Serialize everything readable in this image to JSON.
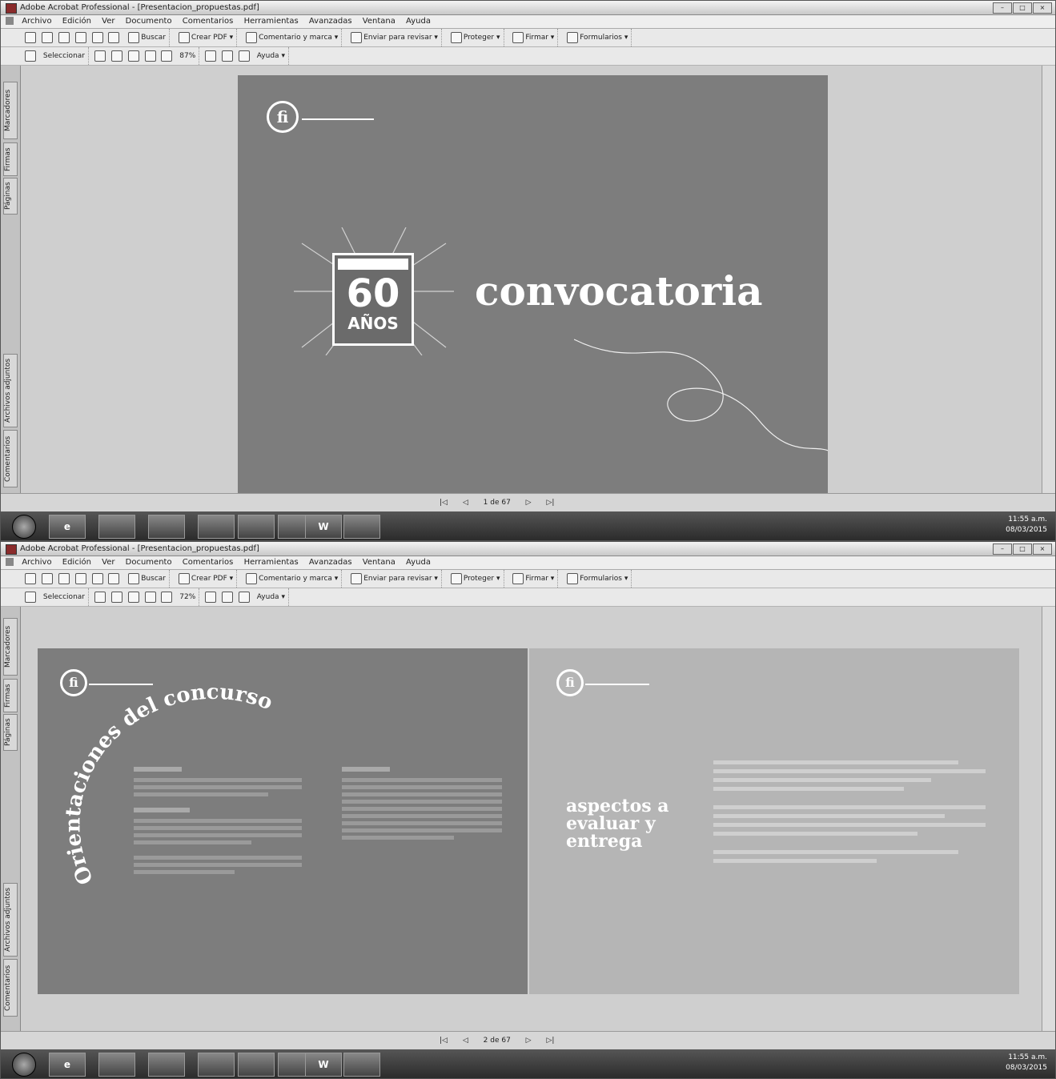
{
  "app": {
    "title": "Adobe Acrobat Professional - [Presentacion_propuestas.pdf]",
    "title_top": "Adobe Acrobat Professional - [Presentacion_propuestas.pdf]",
    "menu": [
      "Archivo",
      "Edición",
      "Ver",
      "Documento",
      "Comentarios",
      "Herramientas",
      "Avanzadas",
      "Ventana",
      "Ayuda"
    ]
  },
  "toolbar1": {
    "buscar": "Buscar",
    "crear_pdf": "Crear PDF",
    "comentario": "Comentario y marca",
    "enviar": "Enviar para revisar",
    "proteger": "Proteger",
    "firmar": "Firmar",
    "formularios": "Formularios"
  },
  "toolbar2": {
    "seleccionar": "Seleccionar",
    "zoom_top": "87%",
    "zoom_bottom": "72%",
    "ayuda": "Ayuda"
  },
  "nav_tabs": [
    "Marcadores",
    "Firmas",
    "Páginas",
    "Archivos adjuntos",
    "Comentarios"
  ],
  "status": {
    "page_top": "1 de 67",
    "page_bottom": "2 de 67"
  },
  "taskbar": {
    "word_label": "W",
    "time": "11:55 a.m.",
    "date": "08/03/2015"
  },
  "slide1": {
    "logo": "fi",
    "anniversary_number": "60",
    "anniversary_word": "AÑOS",
    "title": "convocatoria"
  },
  "slide2": {
    "logo": "fi",
    "arc_title": "Orientaciones del concurso"
  },
  "slide3": {
    "logo": "fi",
    "title": "aspectos a evaluar y entrega"
  },
  "colors": {
    "slide_gray": "#7d7d7d",
    "slide3_gray": "#b5b5b5",
    "taskbar_dark": "#2b2b2b"
  }
}
